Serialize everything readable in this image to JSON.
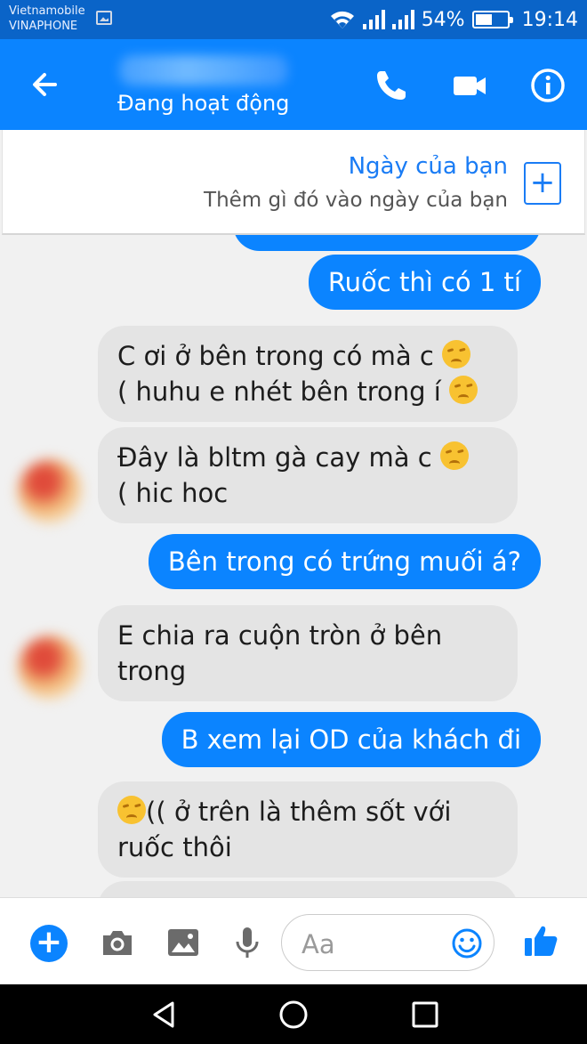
{
  "status_bar": {
    "carrier_1": "Vietnamobile",
    "carrier_2": "VINAPHONE",
    "battery_percent": "54%",
    "battery_level": 0.54,
    "time": "19:14"
  },
  "header": {
    "status": "Đang hoạt động"
  },
  "day_banner": {
    "title": "Ngày của bạn",
    "subtitle": "Thêm gì đó vào ngày của bạn",
    "add_symbol": "+"
  },
  "messages": [
    {
      "direction": "out",
      "text": "Ruốc thì có 1 tí"
    },
    {
      "direction": "in",
      "line1": "C ơi ở bên trong có mà c",
      "line2": "( huhu e nhét bên trong í"
    },
    {
      "direction": "in",
      "line1": "Đây là bltm gà cay mà c",
      "line2": "( hic hoc"
    },
    {
      "direction": "out",
      "text": "Bên trong có trứng muối á?"
    },
    {
      "direction": "in",
      "line1": "E chia ra cuộn tròn ở bên",
      "line2": "trong"
    },
    {
      "direction": "out",
      "text": "B xem lại OD của khách đi"
    },
    {
      "direction": "in",
      "line1": "(( ở trên là thêm sốt với",
      "line2": "ruốc thôi"
    }
  ],
  "composer": {
    "placeholder": "Aa",
    "plus_symbol": "+"
  },
  "colors": {
    "header_blue": "#0b84ff",
    "status_bar_blue": "#0a64c8",
    "incoming_bubble": "#e4e4e4"
  }
}
